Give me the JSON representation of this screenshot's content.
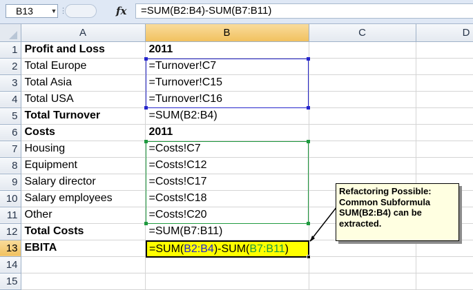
{
  "formula_bar": {
    "name_box": "B13",
    "fx_label": "fx",
    "formula": "=SUM(B2:B4)-SUM(B7:B11)"
  },
  "columns": [
    "A",
    "B",
    "C",
    "D"
  ],
  "rows": [
    {
      "num": "1",
      "a": "Profit and Loss",
      "b": "2011",
      "a_bold": true,
      "b_bold": true
    },
    {
      "num": "2",
      "a": "Total Europe",
      "b": "=Turnover!C7"
    },
    {
      "num": "3",
      "a": "Total Asia",
      "b": "=Turnover!C15"
    },
    {
      "num": "4",
      "a": "Total USA",
      "b": "=Turnover!C16"
    },
    {
      "num": "5",
      "a": "Total Turnover",
      "b": "=SUM(B2:B4)",
      "a_bold": true
    },
    {
      "num": "6",
      "a": "Costs",
      "b": "2011",
      "a_bold": true,
      "b_bold": true
    },
    {
      "num": "7",
      "a": "Housing",
      "b": "=Costs!C7"
    },
    {
      "num": "8",
      "a": "Equipment",
      "b": "=Costs!C12"
    },
    {
      "num": "9",
      "a": "Salary director",
      "b": "=Costs!C17"
    },
    {
      "num": "10",
      "a": "Salary employees",
      "b": "=Costs!C18"
    },
    {
      "num": "11",
      "a": "Other",
      "b": "=Costs!C20"
    },
    {
      "num": "12",
      "a": "Total Costs",
      "b": "=SUM(B7:B11)",
      "a_bold": true
    },
    {
      "num": "13",
      "a": "EBITA",
      "b": "",
      "a_bold": true
    },
    {
      "num": "14",
      "a": "",
      "b": ""
    },
    {
      "num": "15",
      "a": "",
      "b": ""
    }
  ],
  "active_cell": {
    "ref": "B13",
    "part1": "=SUM(",
    "ref1": "B2:B4",
    "part2": ")-SUM(",
    "ref2": "B7:B11",
    "part3": ")"
  },
  "callout": {
    "text": "Refactoring Possible:\nCommon Subformula\nSUM(B2:B4) can be\nextracted."
  },
  "colors": {
    "highlight_fill": "#ffff00",
    "ref_blue": "#2525cc",
    "ref_green": "#1f9a3f",
    "callout_fill": "#ffffe1",
    "selected_header": "#f1c15f"
  }
}
